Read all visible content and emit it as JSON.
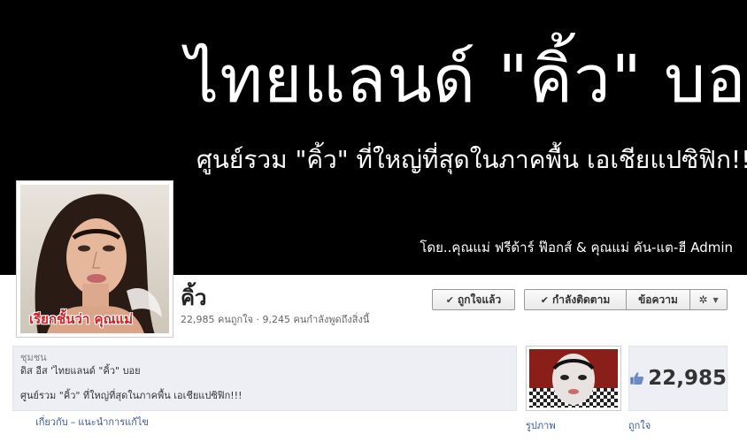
{
  "cover": {
    "title": "ไทยแลนด์ \"คิ้ว\" บอย",
    "subtitle": "ศูนย์รวม \"คิ้ว\" ที่ใหญ่ที่สุดในภาคพื้น เอเชียแปซิฟิก!!!",
    "credit": "โดย..คุณแม่ ฟรีด้าร์ ฟ๊อกส์ & คุณแม่ คัน-แต-ฮี Admin"
  },
  "profile": {
    "caption": "เรียกชั้นว่า คุณแม่"
  },
  "page": {
    "name": "คิ้ว",
    "stats": "22,985 คนถูกใจ · 9,245 คนกำลังพูดถึงสิ่งนี้"
  },
  "actions": {
    "liked_label": "ถูกใจแล้ว",
    "following_label": "กำลังติดตาม",
    "message_label": "ข้อความ"
  },
  "about": {
    "category": "ชุมชน",
    "line1": "ดิส อีส 'ไทยแลนด์ \"คิ้ว\" บอย",
    "line2": "ศูนย์รวม \"คิ้ว\" ที่ใหญ่ที่สุดในภาคพื้น เอเชียแปซิฟิก!!!",
    "link_about": "เกี่ยวกับ",
    "link_separator": "–",
    "link_suggest": "แนะนำการแก้ไข"
  },
  "tiles": {
    "photos_label": "รูปภาพ",
    "likes_label": "ถูกใจ",
    "likes_count": "22,985"
  },
  "colors": {
    "link": "#3b5998",
    "caption_red": "#d21f26",
    "panel_bg": "#edeff4"
  }
}
